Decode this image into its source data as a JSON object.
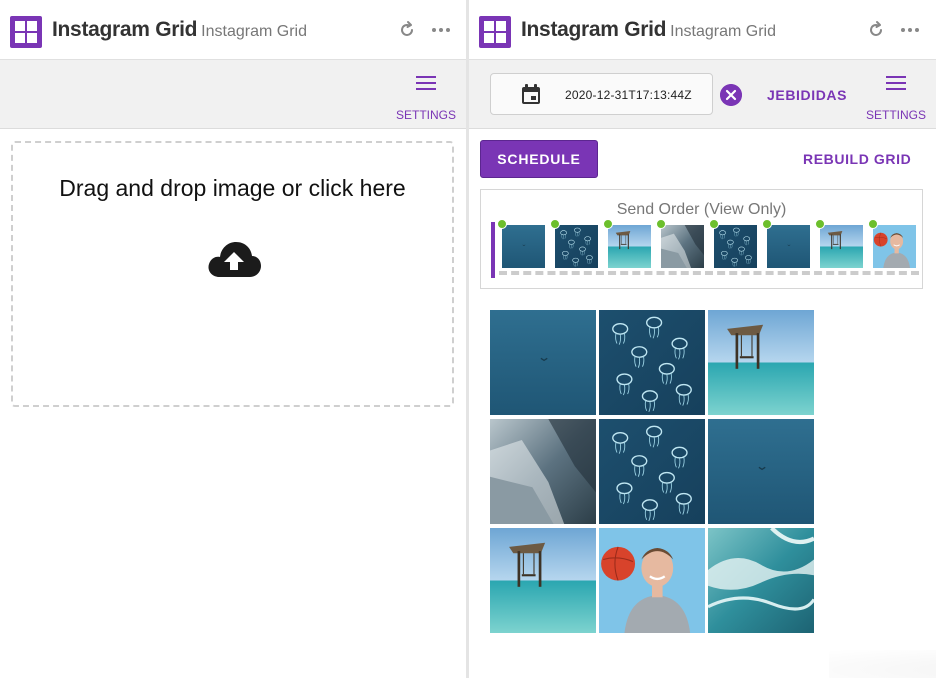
{
  "app": {
    "title": "Instagram Grid",
    "subtitle": "Instagram Grid"
  },
  "colors": {
    "accent": "#7a35b5",
    "success": "#6cbf2c"
  },
  "left_panel": {
    "settings_label": "SETTINGS",
    "dropzone_text": "Drag and drop image or click here"
  },
  "right_panel": {
    "settings_label": "SETTINGS",
    "date_value": "2020-12-31T17:13:44Z",
    "username": "JEBIDIDAS",
    "schedule_label": "SCHEDULE",
    "rebuild_label": "REBUILD GRID",
    "send_order_title": "Send Order (View Only)",
    "send_order_thumbs": [
      "ocean-bird",
      "jellyfish",
      "beach-swing",
      "cliffs",
      "jellyfish",
      "ocean-bird",
      "beach-swing",
      "man-ball"
    ],
    "grid_images": [
      "ocean-bird",
      "jellyfish",
      "beach-swing",
      "cliffs",
      "jellyfish",
      "ocean-bird",
      "beach-swing",
      "man-ball",
      "waves"
    ]
  },
  "icons": {
    "logo": "grid-logo-icon",
    "refresh": "refresh-icon",
    "more": "more-horizontal-icon",
    "menu": "hamburger-menu-icon",
    "upload": "cloud-upload-icon",
    "calendar": "calendar-icon",
    "clear": "close-circle-icon"
  }
}
